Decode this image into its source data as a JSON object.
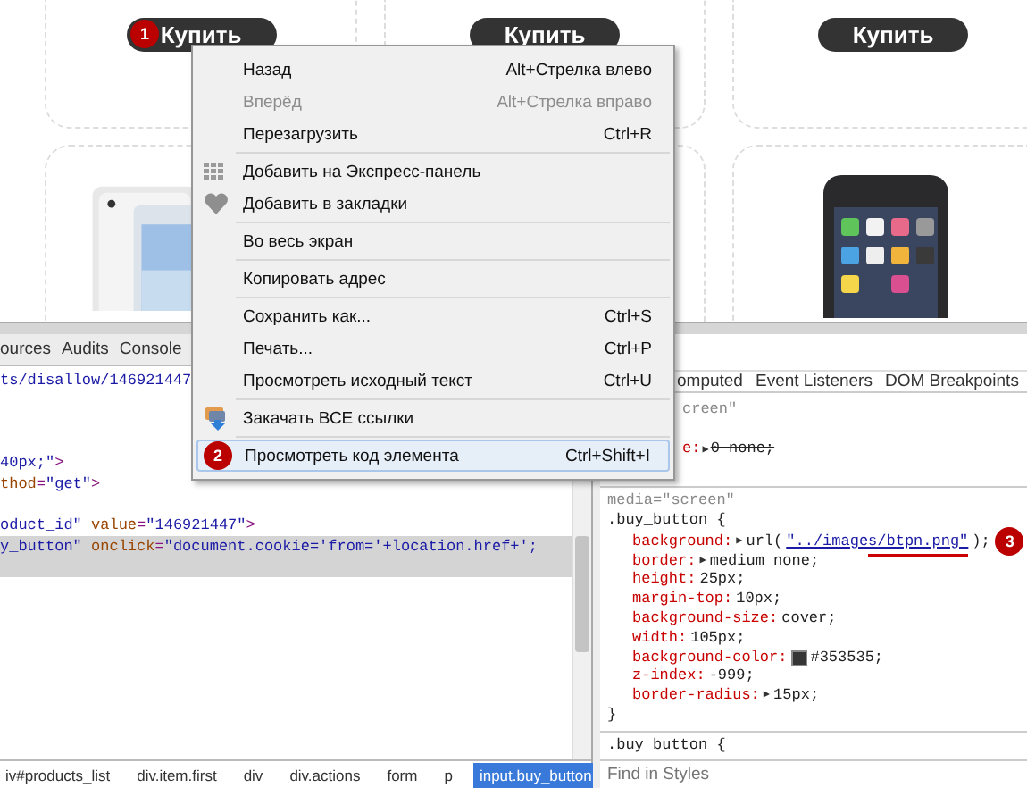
{
  "products_row_1": [
    {
      "button": "Купить",
      "marker": "1"
    },
    {
      "button": "Купить"
    },
    {
      "button": "Купить"
    }
  ],
  "products_row_2": [
    {
      "picture": true
    },
    {
      "picture": true
    }
  ],
  "context_menu": {
    "groups": [
      [
        {
          "label": "Назад",
          "shortcut": "Alt+Стрелка влево",
          "disabled": false,
          "highlighted": false
        },
        {
          "label": "Вперёд",
          "shortcut": "Alt+Стрелка вправо",
          "disabled": true,
          "highlighted": false
        },
        {
          "label": "Перезагрузить",
          "shortcut": "Ctrl+R",
          "disabled": false,
          "highlighted": false
        }
      ],
      [
        {
          "label": "Добавить на Экспресс-панель",
          "disabled": false,
          "highlighted": false
        },
        {
          "label": "Добавить в закладки",
          "disabled": false,
          "highlighted": false
        }
      ],
      [
        {
          "label": "Во весь экран",
          "disabled": false,
          "highlighted": false
        }
      ],
      [
        {
          "label": "Копировать адрес",
          "disabled": false,
          "highlighted": false
        }
      ],
      [
        {
          "label": "Сохранить как...",
          "shortcut": "Ctrl+S",
          "disabled": false,
          "highlighted": false
        },
        {
          "label": "Печать...",
          "shortcut": "Ctrl+P",
          "disabled": false,
          "highlighted": false
        },
        {
          "label": "Просмотреть исходный текст",
          "shortcut": "Ctrl+U",
          "disabled": false,
          "highlighted": false
        }
      ],
      [
        {
          "label": "Закачать ВСЕ ссылки",
          "disabled": false,
          "highlighted": false
        }
      ],
      [
        {
          "label": "Просмотреть код элемента",
          "shortcut": "Ctrl+Shift+I",
          "disabled": false,
          "highlighted": true,
          "marker": "2"
        }
      ]
    ]
  },
  "devtools": {
    "tabs": [
      "ources",
      "Audits",
      "Console"
    ],
    "code_lines": [
      {
        "selected": false,
        "parts": [
          {
            "kind": "value",
            "t": "ts/disallow/146921447"
          }
        ]
      },
      {
        "selected": false,
        "parts": [
          {
            "kind": "value",
            "t": " 40px;\""
          },
          {
            "kind": "tag",
            "t": ">"
          }
        ]
      },
      {
        "selected": false,
        "parts": [
          {
            "kind": "attr",
            "t": "thod"
          },
          {
            "kind": "tag",
            "t": "="
          },
          {
            "kind": "value",
            "t": "\"get\""
          },
          {
            "kind": "tag",
            "t": ">"
          }
        ]
      },
      {
        "selected": false,
        "parts": [
          {
            "kind": "value",
            "t": "oduct_id\""
          },
          {
            "kind": "attr",
            "t": " value"
          },
          {
            "kind": "tag",
            "t": "="
          },
          {
            "kind": "value",
            "t": "\"146921447\""
          },
          {
            "kind": "tag",
            "t": ">"
          }
        ]
      },
      {
        "selected": true,
        "parts": [
          {
            "kind": "value",
            "t": "y_button\""
          },
          {
            "kind": "attr",
            "t": " onclick"
          },
          {
            "kind": "tag",
            "t": "="
          },
          {
            "kind": "value",
            "t": "\"document.cookie='from='+location.href+';"
          }
        ]
      }
    ],
    "breadcrumbs": [
      {
        "label": "iv#products_list",
        "selected": false
      },
      {
        "label": "div.item.first",
        "selected": false
      },
      {
        "label": "div",
        "selected": false
      },
      {
        "label": "div.actions",
        "selected": false
      },
      {
        "label": "form",
        "selected": false
      },
      {
        "label": "p",
        "selected": false
      },
      {
        "label": "input.buy_button",
        "selected": true
      }
    ],
    "styles_tabs": [
      "omputed",
      "Event Listeners",
      "DOM Breakpoints"
    ],
    "rule_1": {
      "media": "creen\"",
      "properties": [
        {
          "name": "e:",
          "expander": "▶",
          "value": "0 none;",
          "overridden": true
        }
      ]
    },
    "rule_2": {
      "media": "media=\"screen\"",
      "selector": ".buy_button {",
      "close": "}",
      "properties": [
        {
          "name": "background:",
          "expander": "▶",
          "prefix": "url(",
          "link": "\"../images/btpn.png\"",
          "suffix": ");",
          "marker": "3"
        },
        {
          "name": "border:",
          "expander": "▶",
          "value": "medium none;"
        },
        {
          "name": "height:",
          "value": "25px;"
        },
        {
          "name": "margin-top:",
          "value": "10px;"
        },
        {
          "name": "background-size:",
          "value": "cover;"
        },
        {
          "name": "width:",
          "value": "105px;"
        },
        {
          "name": "background-color:",
          "value": "#353535;",
          "swatch": true
        },
        {
          "name": "z-index:",
          "value": "-999;"
        },
        {
          "name": "border-radius:",
          "expander": "▶",
          "value": "15px;"
        }
      ]
    },
    "rule_3": {
      "selector": ".buy_button {"
    },
    "find": {
      "placeholder": "Find in Styles"
    }
  }
}
